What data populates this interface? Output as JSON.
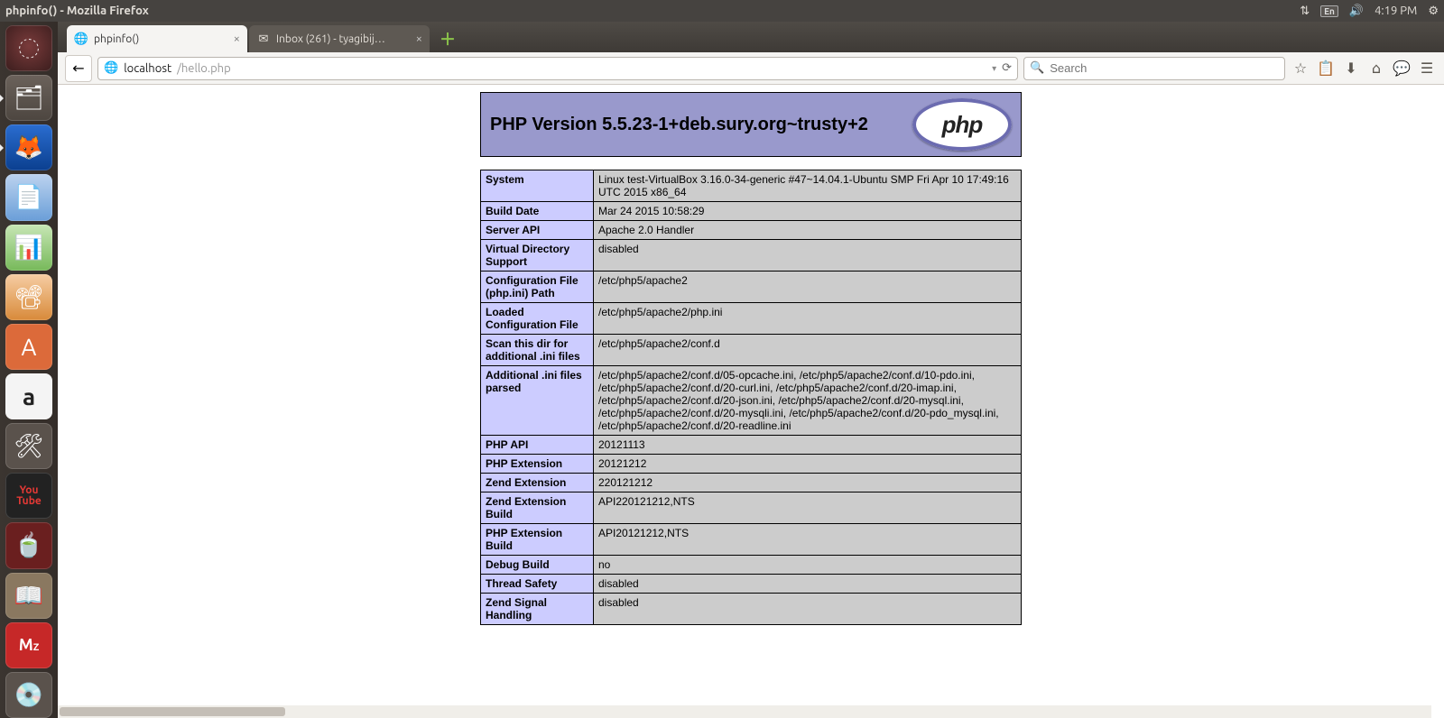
{
  "panel": {
    "window_title": "phpinfo() - Mozilla Firefox",
    "lang": "En",
    "time": "4:19 PM"
  },
  "launcher_names": {
    "dash": "dash-home",
    "files": "files",
    "ffx": "firefox",
    "writer": "libreoffice-writer",
    "calc": "libreoffice-calc",
    "impress": "libreoffice-impress",
    "soft": "ubuntu-software",
    "amazon": "amazon",
    "sys": "system-settings",
    "yt": "youtube",
    "tea": "tea-app",
    "dict": "dictionary",
    "mz": "mz-app",
    "disk": "disk-utility"
  },
  "tabs": [
    {
      "title": "phpinfo()",
      "active": true
    },
    {
      "title": "Inbox (261) - tyagibij…",
      "active": false
    }
  ],
  "url": {
    "host": "localhost",
    "path": "/hello.php"
  },
  "search": {
    "placeholder": "Search"
  },
  "php": {
    "header": "PHP Version 5.5.23-1+deb.sury.org~trusty+2",
    "logo_text": "php",
    "rows": [
      {
        "k": "System",
        "v": "Linux test-VirtualBox 3.16.0-34-generic #47~14.04.1-Ubuntu SMP Fri Apr 10 17:49:16 UTC 2015 x86_64"
      },
      {
        "k": "Build Date",
        "v": "Mar 24 2015 10:58:29"
      },
      {
        "k": "Server API",
        "v": "Apache 2.0 Handler"
      },
      {
        "k": "Virtual Directory Support",
        "v": "disabled"
      },
      {
        "k": "Configuration File (php.ini) Path",
        "v": "/etc/php5/apache2"
      },
      {
        "k": "Loaded Configuration File",
        "v": "/etc/php5/apache2/php.ini"
      },
      {
        "k": "Scan this dir for additional .ini files",
        "v": "/etc/php5/apache2/conf.d"
      },
      {
        "k": "Additional .ini files parsed",
        "v": "/etc/php5/apache2/conf.d/05-opcache.ini, /etc/php5/apache2/conf.d/10-pdo.ini, /etc/php5/apache2/conf.d/20-curl.ini, /etc/php5/apache2/conf.d/20-imap.ini, /etc/php5/apache2/conf.d/20-json.ini, /etc/php5/apache2/conf.d/20-mysql.ini, /etc/php5/apache2/conf.d/20-mysqli.ini, /etc/php5/apache2/conf.d/20-pdo_mysql.ini, /etc/php5/apache2/conf.d/20-readline.ini"
      },
      {
        "k": "PHP API",
        "v": "20121113"
      },
      {
        "k": "PHP Extension",
        "v": "20121212"
      },
      {
        "k": "Zend Extension",
        "v": "220121212"
      },
      {
        "k": "Zend Extension Build",
        "v": "API220121212,NTS"
      },
      {
        "k": "PHP Extension Build",
        "v": "API20121212,NTS"
      },
      {
        "k": "Debug Build",
        "v": "no"
      },
      {
        "k": "Thread Safety",
        "v": "disabled"
      },
      {
        "k": "Zend Signal Handling",
        "v": "disabled"
      }
    ]
  }
}
